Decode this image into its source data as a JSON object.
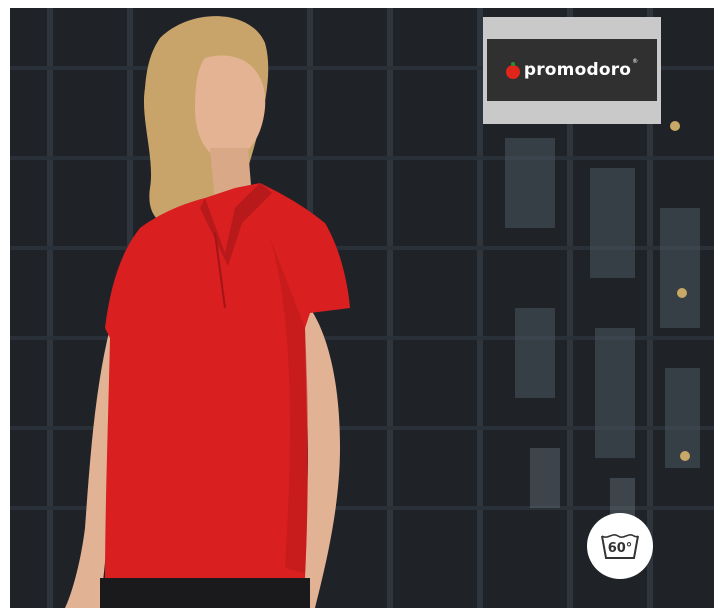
{
  "brand": {
    "name": "promodoro",
    "registered": "®",
    "tomato_color": "#e0251b"
  },
  "care_label": {
    "icon": "wash-60-icon",
    "temperature": "60°"
  },
  "photo": {
    "subject": "woman-in-red-polo-shirt",
    "shirt_color": "#d91f1f",
    "background": "dark-glass-building-facade"
  }
}
